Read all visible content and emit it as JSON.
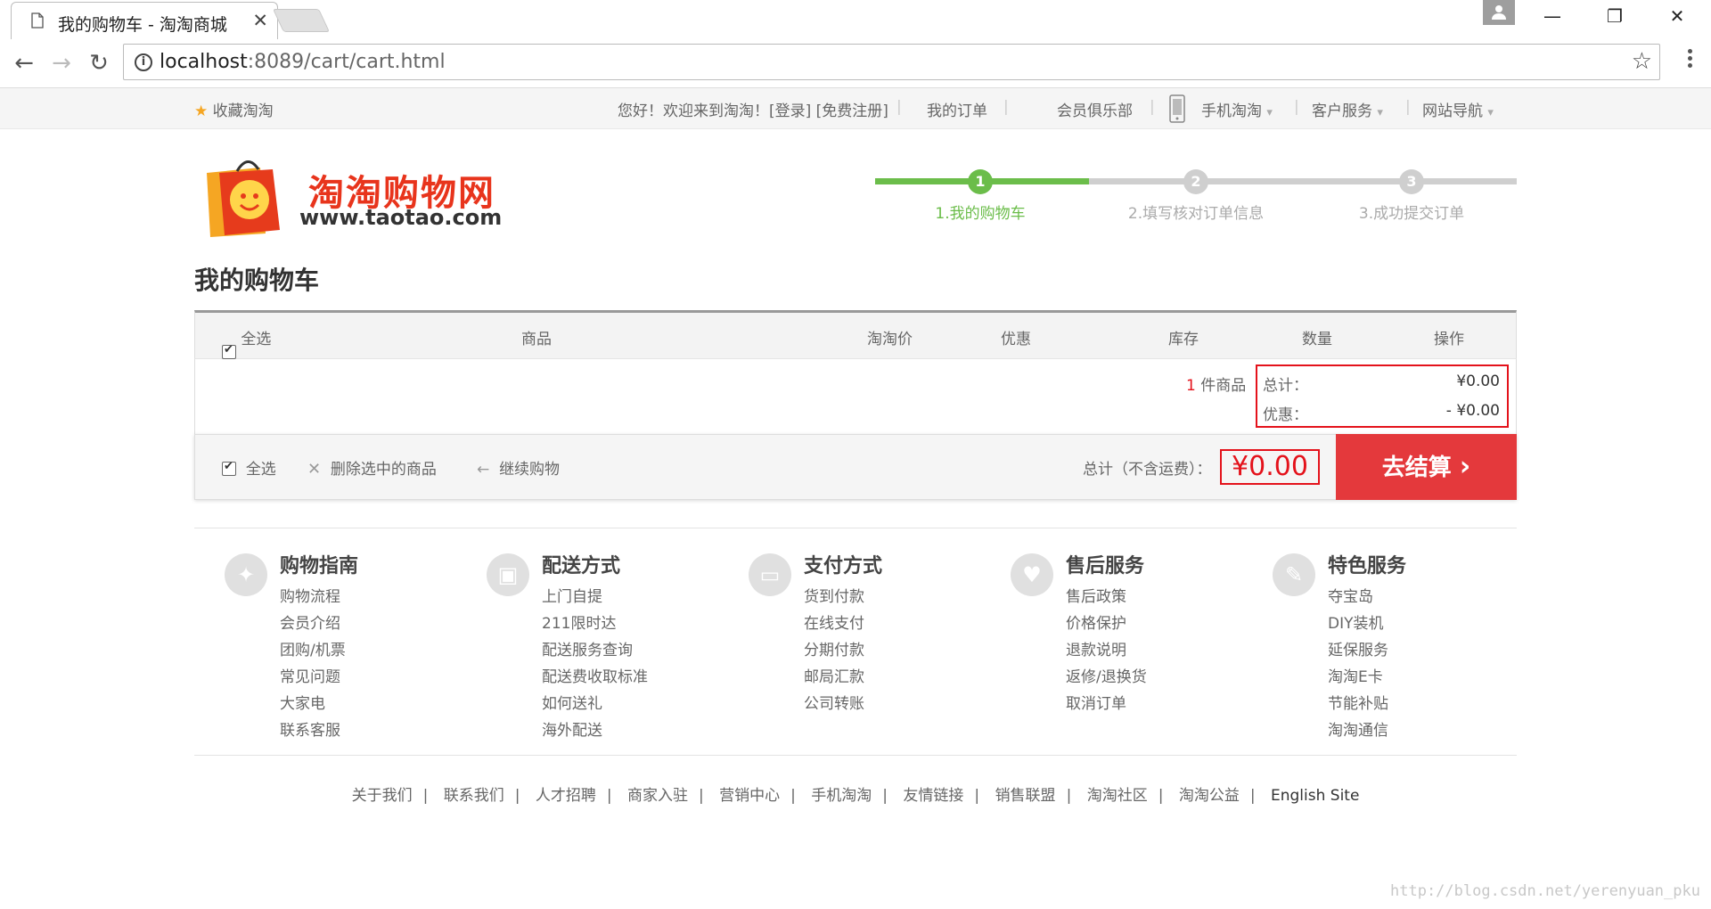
{
  "browser": {
    "tab_title": "我的购物车 - 淘淘商城",
    "url_host": "localhost",
    "url_rest": ":8089/cart/cart.html",
    "minimize": "—",
    "restore": "❐",
    "close": "✕"
  },
  "topbar": {
    "favorite": "收藏淘淘",
    "welcome": "您好！欢迎来到淘淘！[登录] [免费注册]",
    "my_orders": "我的订单",
    "member_club": "会员俱乐部",
    "mobile": "手机淘淘",
    "service": "客户服务",
    "site_nav": "网站导航"
  },
  "logo": {
    "text": "淘淘购物网",
    "url": "www.taotao.com"
  },
  "steps": [
    {
      "num": "1",
      "label": "1.我的购物车"
    },
    {
      "num": "2",
      "label": "2.填写核对订单信息"
    },
    {
      "num": "3",
      "label": "3.成功提交订单"
    }
  ],
  "page_title": "我的购物车",
  "cart": {
    "headers": {
      "select_all": "全选",
      "product": "商品",
      "price": "淘淘价",
      "discount": "优惠",
      "stock": "库存",
      "quantity": "数量",
      "action": "操作"
    },
    "item_count": "1",
    "item_count_suffix": "件商品",
    "total_label": "总计：",
    "total_value": "¥0.00",
    "discount_label": "优惠：",
    "discount_value": "- ¥0.00",
    "footer": {
      "select_all": "全选",
      "delete_selected": "删除选中的商品",
      "continue_shopping": "继续购物",
      "total_label": "总计（不含运费）：",
      "total_value": "¥0.00",
      "checkout": "去结算"
    }
  },
  "footer_columns": [
    {
      "title": "购物指南",
      "icon": "compass-icon",
      "links": [
        "购物流程",
        "会员介绍",
        "团购/机票",
        "常见问题",
        "大家电",
        "联系客服"
      ]
    },
    {
      "title": "配送方式",
      "icon": "bus-icon",
      "links": [
        "上门自提",
        "211限时达",
        "配送服务查询",
        "配送费收取标准",
        "如何送礼",
        "海外配送"
      ]
    },
    {
      "title": "支付方式",
      "icon": "wallet-icon",
      "links": [
        "货到付款",
        "在线支付",
        "分期付款",
        "邮局汇款",
        "公司转账"
      ]
    },
    {
      "title": "售后服务",
      "icon": "heart-icon",
      "links": [
        "售后政策",
        "价格保护",
        "退款说明",
        "返修/退换货",
        "取消订单"
      ]
    },
    {
      "title": "特色服务",
      "icon": "wrench-icon",
      "links": [
        "夺宝岛",
        "DIY装机",
        "延保服务",
        "淘淘E卡",
        "节能补贴",
        "淘淘通信"
      ]
    }
  ],
  "bottom_links": [
    "关于我们",
    "联系我们",
    "人才招聘",
    "商家入驻",
    "营销中心",
    "手机淘淘",
    "友情链接",
    "销售联盟",
    "淘淘社区",
    "淘淘公益",
    "English Site"
  ],
  "watermark": "http://blog.csdn.net/yerenyuan_pku",
  "colors": {
    "accent_red": "#e4393c",
    "step_green": "#6bbd4a",
    "border_red": "#e4121b"
  }
}
